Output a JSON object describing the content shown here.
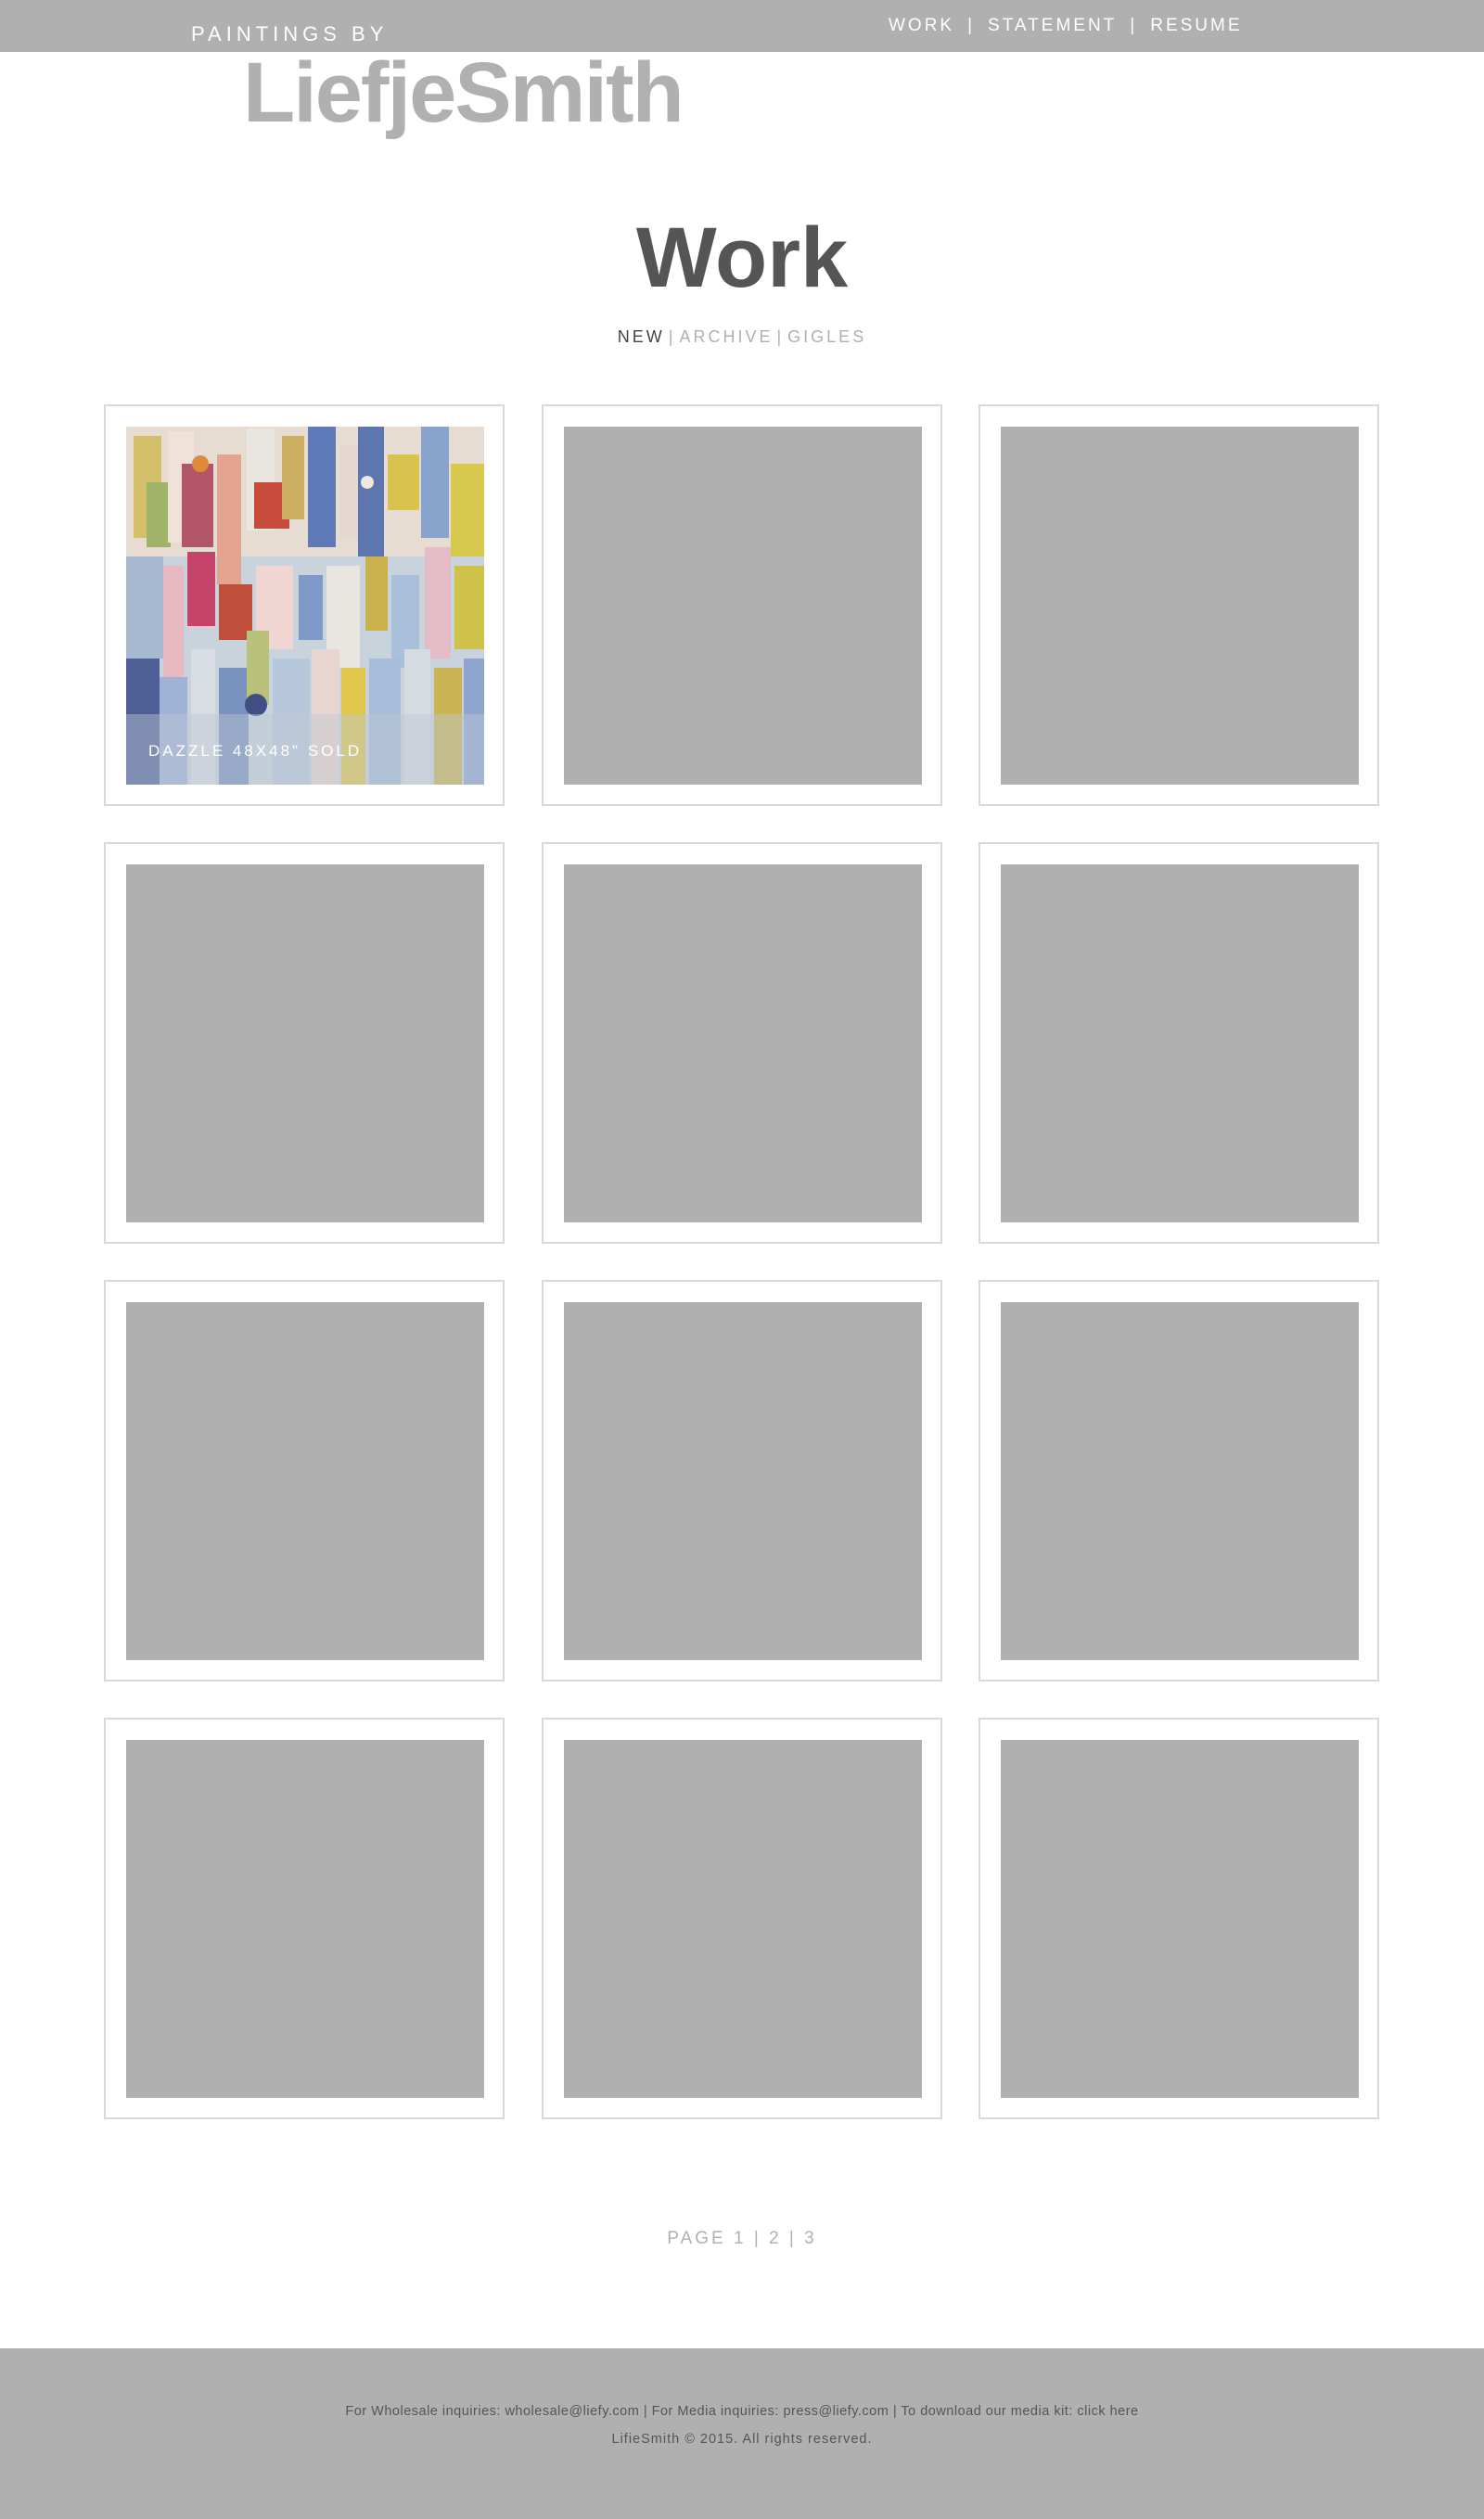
{
  "header": {
    "tagline": "PAINTINGS BY",
    "brand": "LiefjeSmith",
    "nav": [
      {
        "label": "WORK"
      },
      {
        "label": "STATEMENT"
      },
      {
        "label": "RESUME"
      }
    ],
    "nav_separator": "|"
  },
  "main": {
    "title": "Work",
    "filters": [
      {
        "label": "NEW",
        "active": true
      },
      {
        "label": "ARCHIVE",
        "active": false
      },
      {
        "label": "GIGLES",
        "active": false
      }
    ],
    "filter_separator": "|",
    "gallery": [
      {
        "caption": "DAZZLE 48X48\" SOLD",
        "has_image": true
      },
      {
        "caption": "",
        "has_image": false
      },
      {
        "caption": "",
        "has_image": false
      },
      {
        "caption": "",
        "has_image": false
      },
      {
        "caption": "",
        "has_image": false
      },
      {
        "caption": "",
        "has_image": false
      },
      {
        "caption": "",
        "has_image": false
      },
      {
        "caption": "",
        "has_image": false
      },
      {
        "caption": "",
        "has_image": false
      },
      {
        "caption": "",
        "has_image": false
      },
      {
        "caption": "",
        "has_image": false
      },
      {
        "caption": "",
        "has_image": false
      }
    ],
    "pagination": {
      "label": "PAGE",
      "pages": [
        "1",
        "2",
        "3"
      ],
      "separator": "|"
    }
  },
  "footer": {
    "wholesale_text": "For Wholesale inquiries: ",
    "wholesale_email": "wholesale@liefy.com",
    "media_text": " | For Media inquiries: ",
    "media_email": "press@liefy.com",
    "kit_text": " |  To download our media kit: ",
    "kit_link": "click here",
    "copyright": "LifieSmith ©  2015.  All rights reserved."
  },
  "colors": {
    "bar_gray": "#b0b0b0",
    "title_gray": "#555555",
    "placeholder_gray": "#b0b0b0",
    "border_gray": "#d9d9d9"
  }
}
